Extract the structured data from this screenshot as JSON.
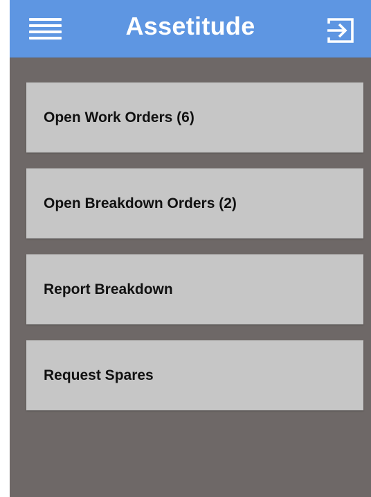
{
  "app": {
    "title": "Assetitude"
  },
  "header": {
    "menu_icon": "hamburger-menu-icon",
    "logout_icon": "logout-arrow-icon"
  },
  "menu": {
    "items": [
      {
        "label": "Open Work Orders (6)"
      },
      {
        "label": "Open Breakdown Orders (2)"
      },
      {
        "label": "Report Breakdown"
      },
      {
        "label": "Request Spares"
      }
    ]
  },
  "colors": {
    "appbar": "#5e96e2",
    "background": "#6e6867",
    "card": "#c6c6c6",
    "text": "#111111"
  }
}
